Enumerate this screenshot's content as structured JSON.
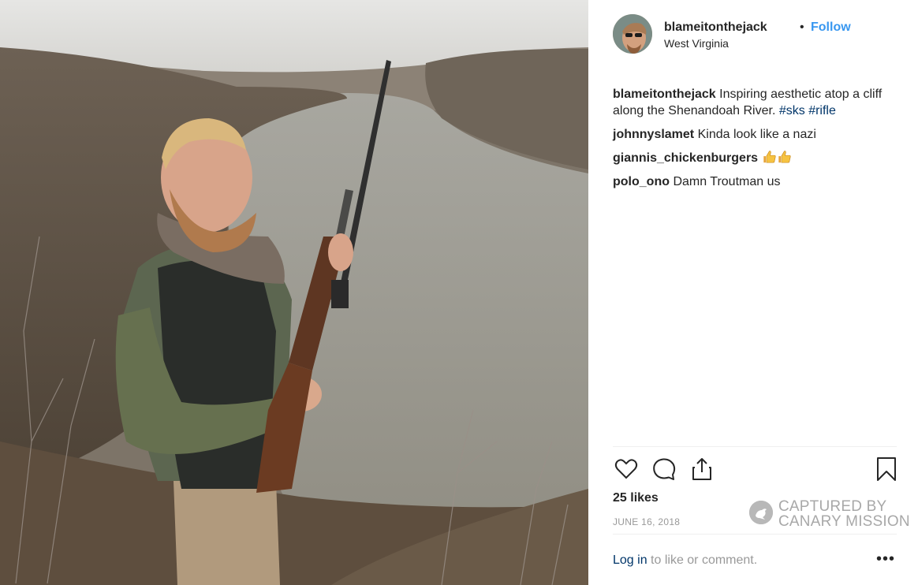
{
  "post": {
    "username": "blameitonthejack",
    "separator": "•",
    "follow_label": "Follow",
    "location": "West Virginia"
  },
  "comments": [
    {
      "user": "blameitonthejack",
      "text": "Inspiring aesthetic atop a cliff along the Shenandoah River.",
      "tags": [
        "#sks",
        "#rifle"
      ]
    },
    {
      "user": "johnnyslamet",
      "text": "Kinda look like a nazi"
    },
    {
      "user": "giannis_chickenburgers",
      "text": ""
    },
    {
      "user": "polo_ono",
      "text": "Damn Troutman us"
    }
  ],
  "actions": {
    "like_icon": "heart-icon",
    "comment_icon": "comment-bubble-icon",
    "share_icon": "share-icon",
    "save_icon": "bookmark-icon"
  },
  "likes_label": "25 likes",
  "date_label": "JUNE 16, 2018",
  "watermark": {
    "line1": "CAPTURED BY",
    "line2": "CANARY MISSION"
  },
  "footer": {
    "login_label": "Log in",
    "rest_label": " to like or comment.",
    "more_label": "•••"
  },
  "colors": {
    "link_blue": "#3897f0",
    "hashtag_blue": "#003569",
    "muted_gray": "#999999"
  }
}
